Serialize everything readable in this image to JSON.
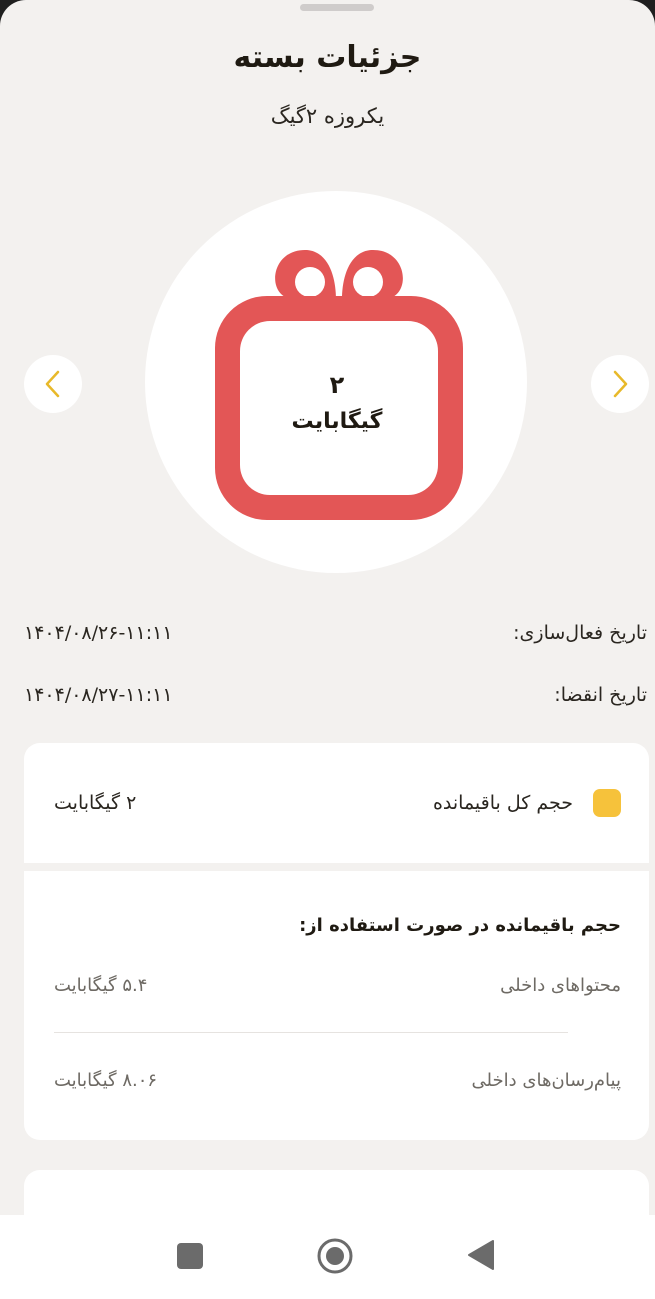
{
  "header": {
    "title": "جزئیات بسته",
    "subtitle": "یکروزه ۲گیگ"
  },
  "gift": {
    "amount": "۲",
    "unit": "گیگابایت",
    "color": "#e35656"
  },
  "carousel": {
    "prev_icon": "chevron-left-icon",
    "next_icon": "chevron-right-icon",
    "accent": "#e8b92a"
  },
  "dates": {
    "activation_label": "تاریخ فعال‌سازی:",
    "activation_value": "۱۴۰۴/۰۸/۲۶-۱۱:۱۱",
    "expiry_label": "تاریخ انقضا:",
    "expiry_value": "۱۴۰۴/۰۸/۲۷-۱۱:۱۱"
  },
  "total": {
    "label": "حجم کل باقیمانده",
    "value": "۲ گیگابایت",
    "marker_color": "#f6c23b"
  },
  "usage": {
    "heading": "حجم باقیمانده در صورت استفاده از:",
    "items": [
      {
        "label": "محتواهای داخلی",
        "value": "۵.۴ گیگابایت"
      },
      {
        "label": "پیام‌رسان‌های داخلی",
        "value": "۸.۰۶ گیگابایت"
      }
    ]
  },
  "system_nav": {
    "recents_icon": "square-icon",
    "home_icon": "circle-home-icon",
    "back_icon": "triangle-back-icon"
  }
}
